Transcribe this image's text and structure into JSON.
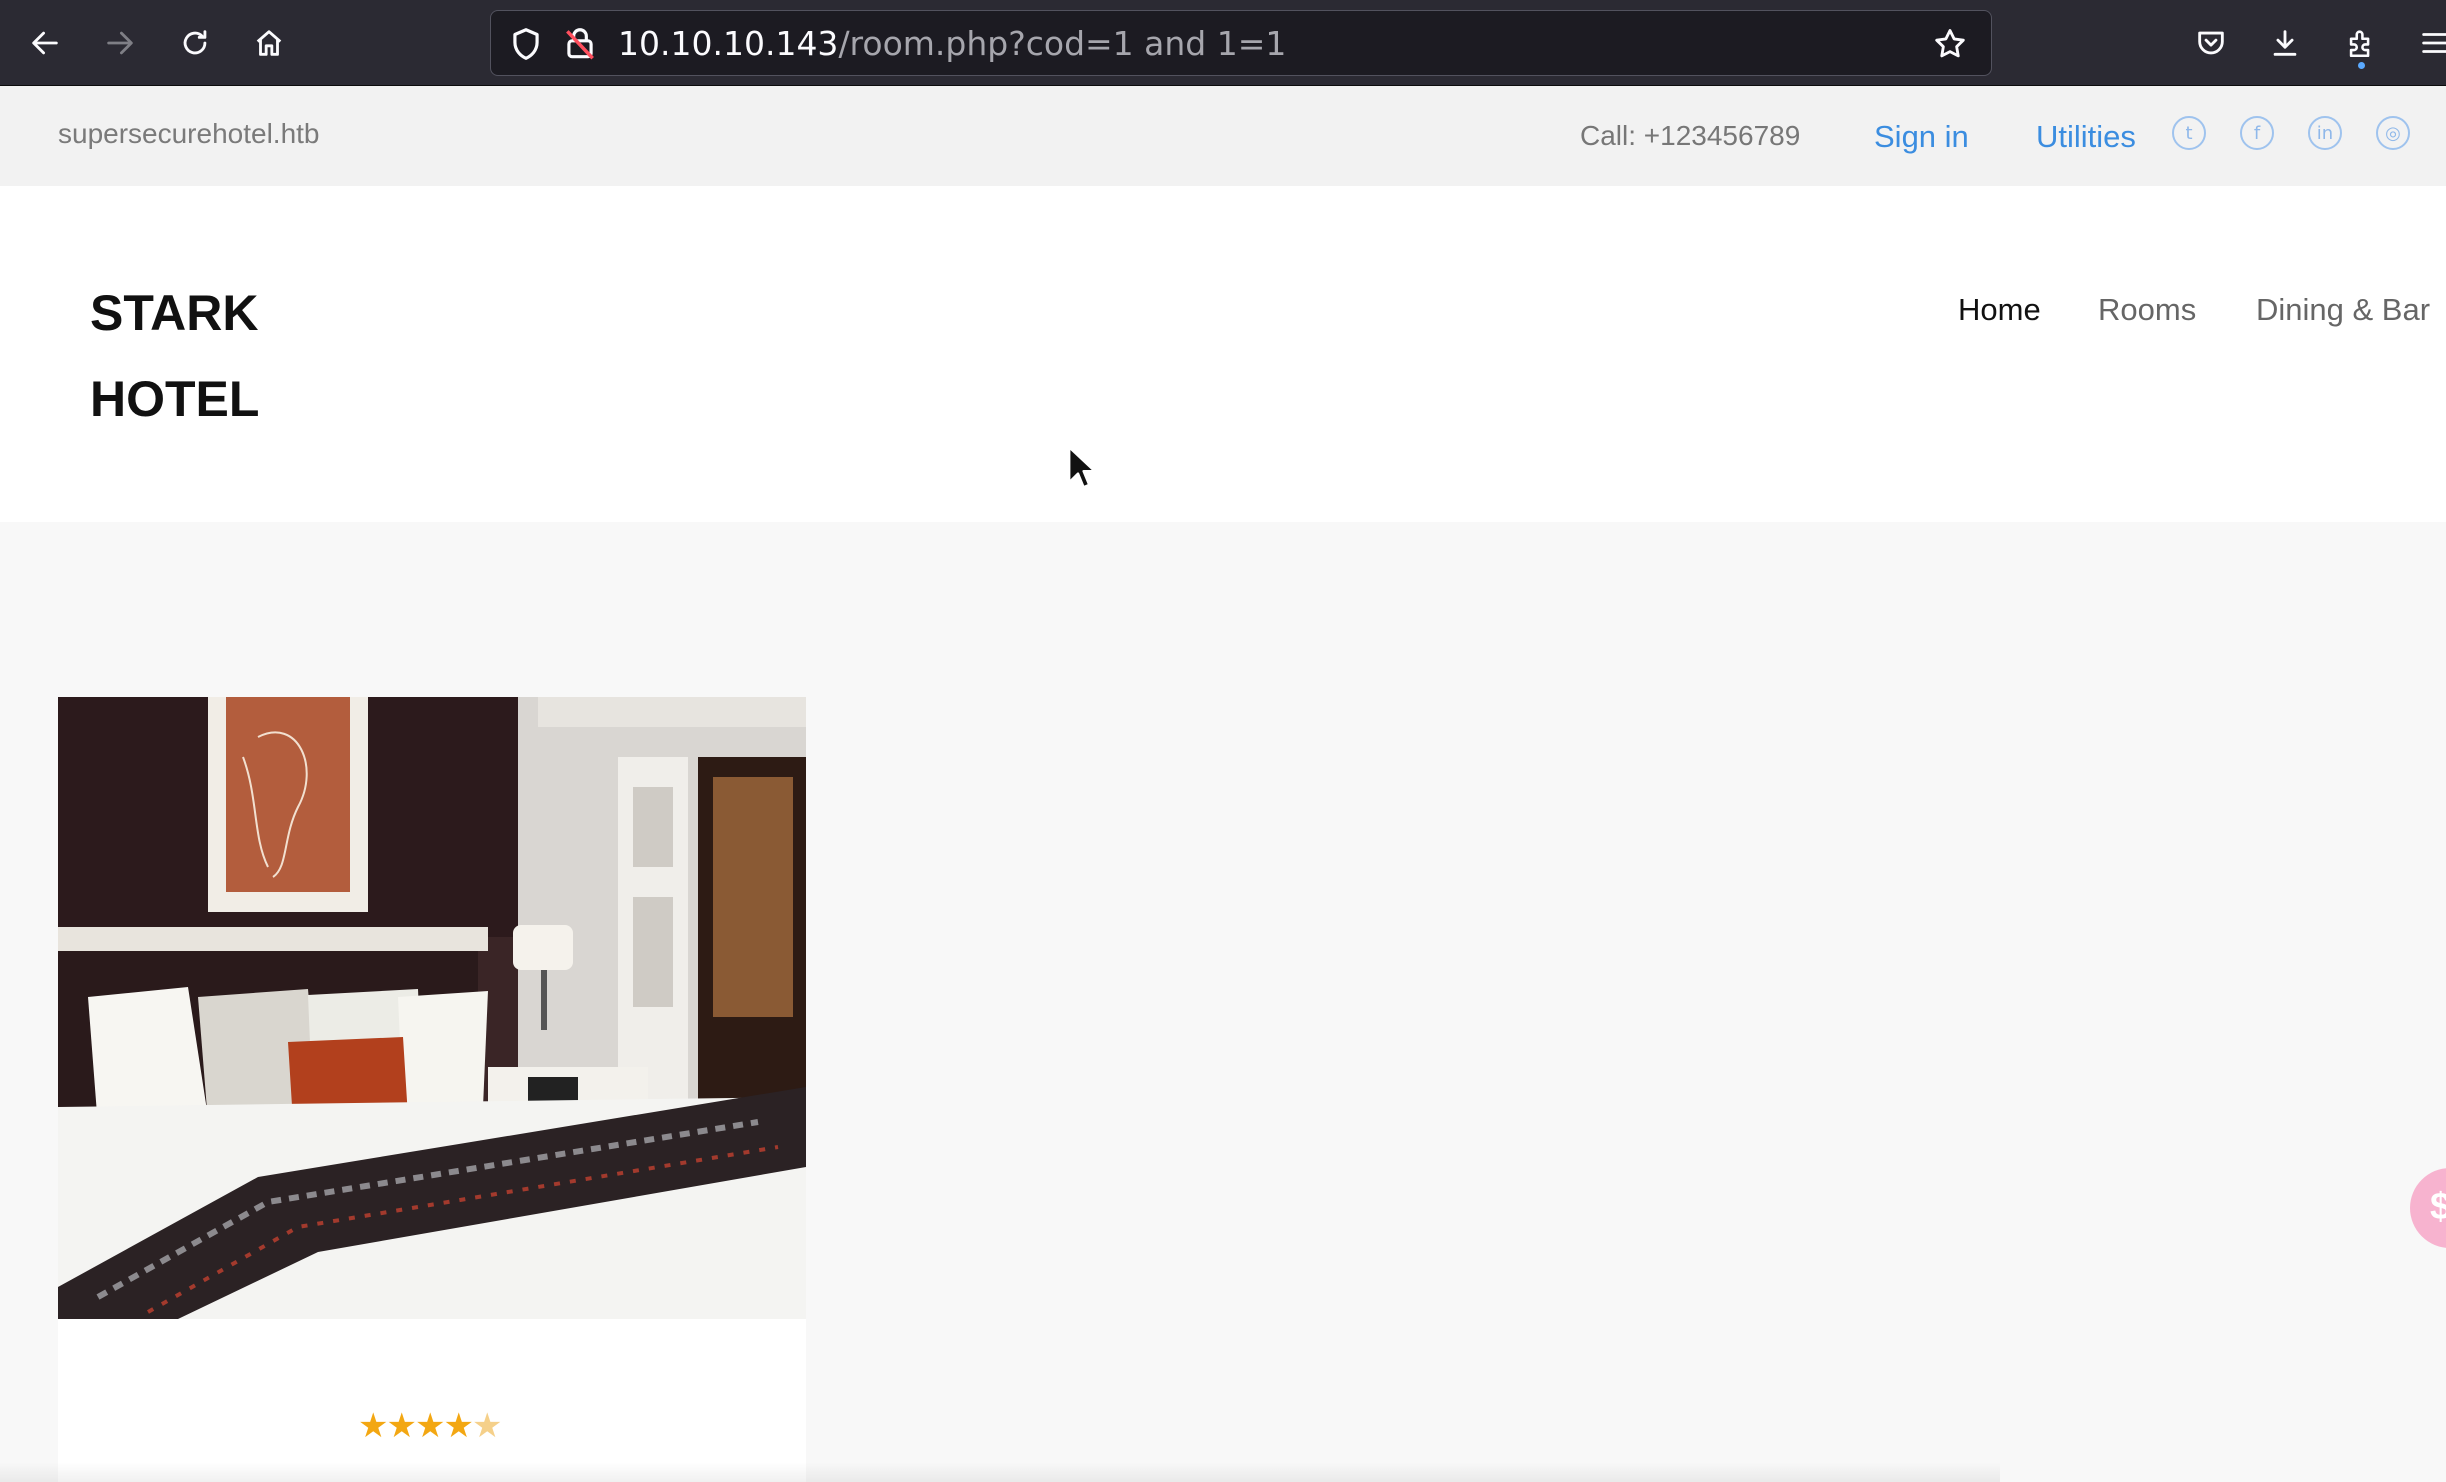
{
  "browser": {
    "url_host": "10.10.10.143",
    "url_path": "/room.php?cod=1 and 1=1",
    "icons": [
      "back-icon",
      "forward-icon",
      "reload-icon",
      "home-icon",
      "shield-icon",
      "insecure-lock-icon",
      "bookmark-star-icon",
      "pocket-icon",
      "download-icon",
      "extensions-icon",
      "menu-icon"
    ]
  },
  "topbar": {
    "domain": "supersecurehotel.htb",
    "phone": "Call: +123456789",
    "signin": "Sign in",
    "utilities": "Utilities",
    "social_icons": [
      "twitter-icon",
      "facebook-icon",
      "linkedin-icon",
      "dribbble-icon"
    ]
  },
  "header": {
    "logo_line1": "STARK",
    "logo_line2": "HOTEL",
    "nav": [
      "Home",
      "Rooms",
      "Dining & Bar"
    ],
    "active": "Home"
  },
  "room": {
    "rating": 4,
    "rating_max": 5,
    "photo": "hotel-bedroom-photo"
  },
  "colors": {
    "link": "#3b8de0",
    "star": "#f3a712",
    "chrome": "#2b2a33"
  }
}
